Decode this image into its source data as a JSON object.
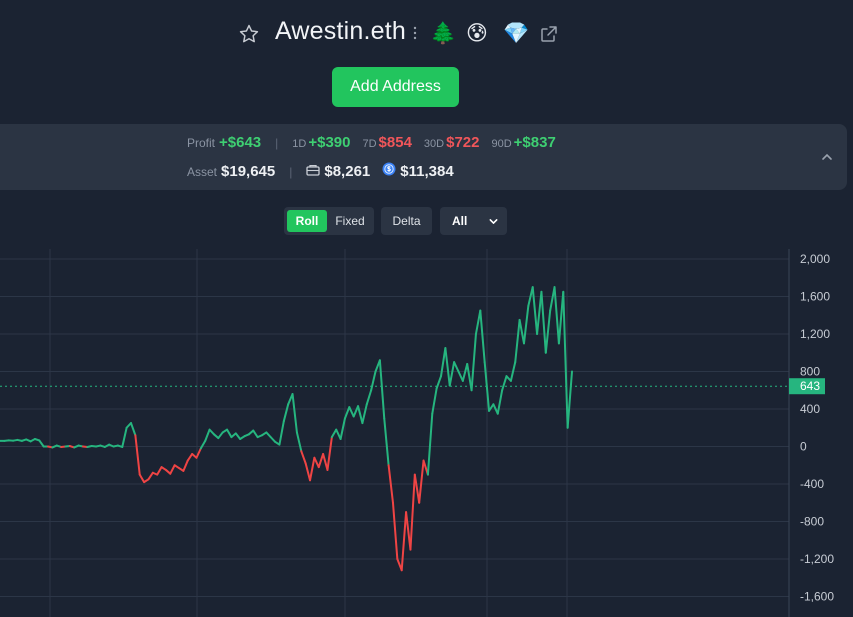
{
  "header": {
    "title": "Awestin.eth",
    "emojis": [
      "🌲",
      "😰",
      "💎"
    ]
  },
  "add_address_label": "Add Address",
  "summary": {
    "profit_label": "Profit",
    "profit_value": "+$643",
    "d1_label": "1D",
    "d1_value": "+$390",
    "d7_label": "7D",
    "d7_value": "$854",
    "d30_label": "30D",
    "d30_value": "$722",
    "d90_label": "90D",
    "d90_value": "+$837",
    "asset_label": "Asset",
    "asset_value": "$19,645",
    "wallet_value": "$8,261",
    "token_value": "$11,384"
  },
  "controls": {
    "roll_label": "Roll",
    "fixed_label": "Fixed",
    "delta_label": "Delta",
    "range_selected": "All"
  },
  "colors": {
    "positive": "#26b57f",
    "negative": "#ef4444",
    "accent": "#22c55e"
  },
  "chart_data": {
    "type": "line",
    "ylim": [
      -1700,
      2050
    ],
    "y_ticks": [
      2000,
      1600,
      1200,
      800,
      400,
      0,
      -400,
      -800,
      -1200,
      -1600
    ],
    "y_tick_labels": [
      "2,000",
      "1,600",
      "1,200",
      "800",
      "400",
      "0",
      "-400",
      "-800",
      "-1,200",
      "-1,600"
    ],
    "current_value": 643,
    "current_label": "643",
    "series": [
      {
        "values": [
          60,
          60,
          65,
          62,
          70,
          60,
          75,
          55,
          80,
          65,
          0,
          0,
          -10,
          10,
          -5,
          0,
          5,
          -10,
          10,
          0,
          -5,
          5,
          0,
          10,
          -5,
          20,
          0,
          10,
          -5,
          200,
          250,
          120,
          -300,
          -380,
          -350,
          -280,
          -300,
          -220,
          -250,
          -290,
          -200,
          -230,
          -260,
          -150,
          -80,
          -120,
          -20,
          60,
          180,
          130,
          90,
          150,
          180,
          100,
          140,
          80,
          110,
          130,
          170,
          100,
          120,
          150,
          100,
          50,
          20,
          270,
          450,
          560,
          150,
          -50,
          -180,
          -360,
          -120,
          -220,
          -80,
          -250,
          100,
          180,
          80,
          300,
          420,
          320,
          430,
          250,
          450,
          600,
          800,
          920,
          300,
          -200,
          -600,
          -1200,
          -1320,
          -700,
          -1100,
          -300,
          -600,
          -150,
          -300,
          350,
          620,
          750,
          1050,
          650,
          900,
          800,
          700,
          880,
          600,
          1200,
          1450,
          900,
          380,
          450,
          350,
          600,
          750,
          700,
          900,
          1350,
          1100,
          1500,
          1700,
          1200,
          1650,
          1000,
          1450,
          1700,
          1100,
          1650,
          200,
          800
        ]
      }
    ]
  }
}
